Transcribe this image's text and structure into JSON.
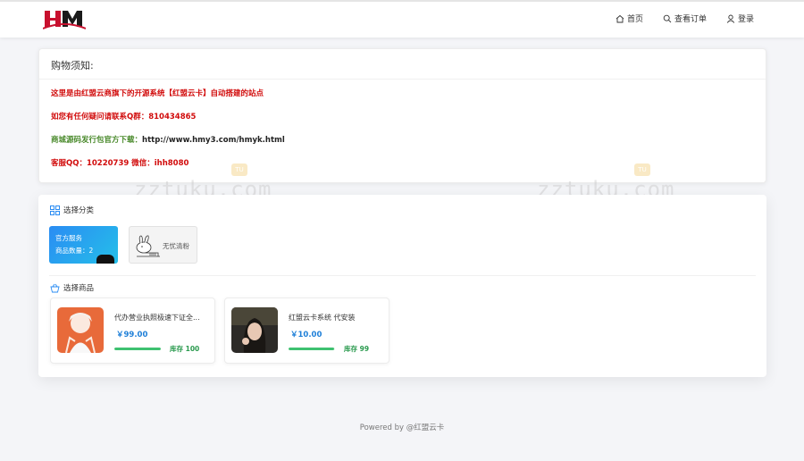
{
  "header": {
    "logo_text": "HM",
    "nav": [
      {
        "label": "首页",
        "icon": "home-icon"
      },
      {
        "label": "查看订单",
        "icon": "search-icon"
      },
      {
        "label": "登录",
        "icon": "user-icon"
      }
    ]
  },
  "notice": {
    "title": "购物须知:",
    "lines": [
      "这里是由红盟云商旗下的开源系统【红盟云卡】自动搭建的站点",
      "如您有任何疑问请联系Q群：810434865",
      "商城源码发行包官方下载：",
      "客服QQ：10220739  微信：ihh8080"
    ],
    "download_url": "http://www.hmy3.com/hmyk.html"
  },
  "categories": {
    "heading": "选择分类",
    "items": [
      {
        "name": "官方服务",
        "count_label": "商品数量：2",
        "active": true
      },
      {
        "name": "无忧清粉",
        "active": false
      }
    ]
  },
  "goods": {
    "heading": "选择商品",
    "items": [
      {
        "name": "代办营业执照极速下证全...",
        "price": "￥99.00",
        "stock": "库存 100",
        "stock_level": 1.0
      },
      {
        "name": "红盟云卡系统 代安装",
        "price": "￥10.00",
        "stock": "库存 99",
        "stock_level": 0.99
      }
    ]
  },
  "watermark": {
    "text": "zztuku.com",
    "badge": "TU"
  },
  "footer": {
    "text": "Powered by @红盟云卡"
  },
  "colors": {
    "accent": "#1e7fd8",
    "notice_red": "#d10b0b",
    "notice_green": "#4a8a2c",
    "stock_green": "#3ec170"
  }
}
